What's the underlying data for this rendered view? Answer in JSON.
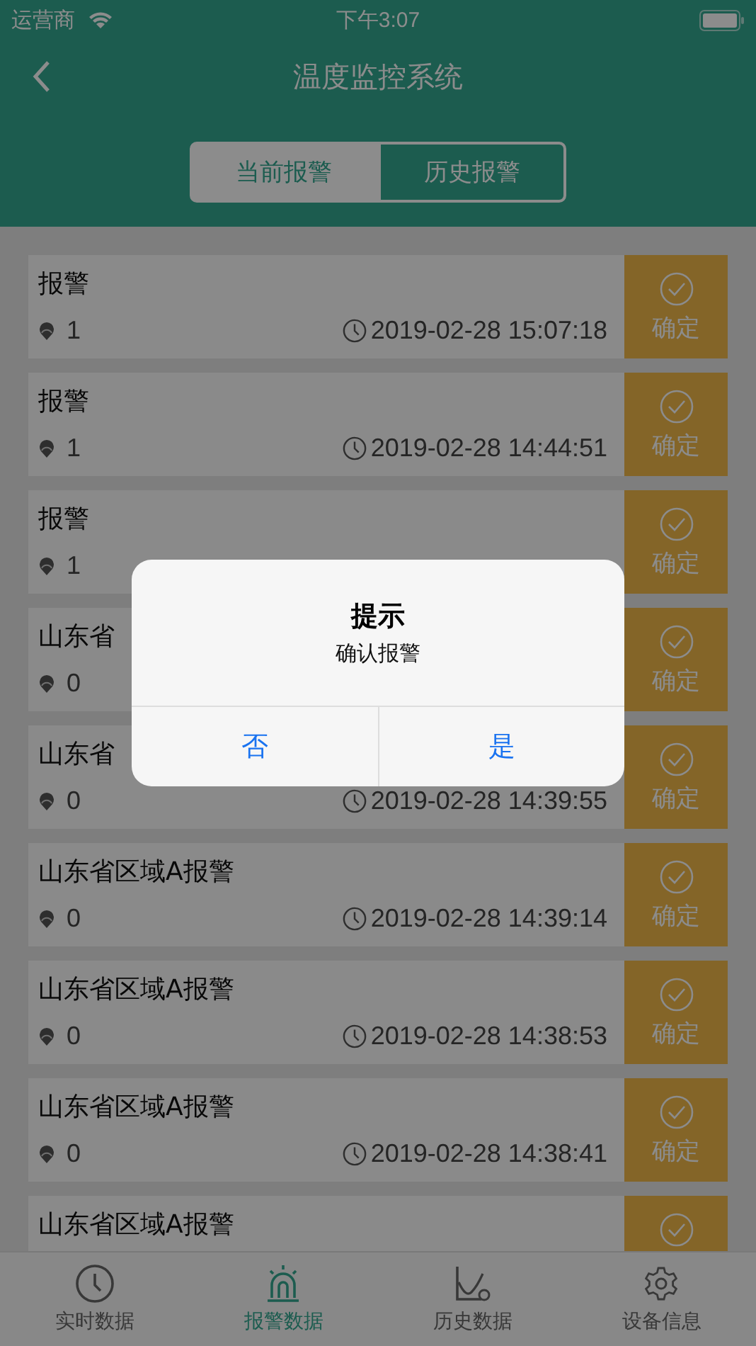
{
  "status_bar": {
    "carrier": "运营商",
    "time": "下午3:07"
  },
  "nav": {
    "title": "温度监控系统"
  },
  "segments": [
    {
      "label": "当前报警",
      "selected": true
    },
    {
      "label": "历史报警",
      "selected": false
    }
  ],
  "alarms": [
    {
      "title": "报警",
      "count": "1",
      "time": "2019-02-28 15:07:18",
      "confirm": "确定"
    },
    {
      "title": "报警",
      "count": "1",
      "time": "2019-02-28 14:44:51",
      "confirm": "确定"
    },
    {
      "title": "报警",
      "count": "1",
      "confirm": "确定"
    },
    {
      "title": "山东省",
      "count": "0",
      "confirm": "确定"
    },
    {
      "title": "山东省",
      "count": "0",
      "time": "2019-02-28 14:39:55",
      "confirm": "确定"
    },
    {
      "title": "山东省区域A报警",
      "count": "0",
      "time": "2019-02-28 14:39:14",
      "confirm": "确定"
    },
    {
      "title": "山东省区域A报警",
      "count": "0",
      "time": "2019-02-28 14:38:53",
      "confirm": "确定"
    },
    {
      "title": "山东省区域A报警",
      "count": "0",
      "time": "2019-02-28 14:38:41",
      "confirm": "确定"
    },
    {
      "title": "山东省区域A报警"
    }
  ],
  "tab_bar": [
    {
      "label": "实时数据",
      "kind": "clock",
      "selected": false
    },
    {
      "label": "报警数据",
      "kind": "alarm",
      "selected": true
    },
    {
      "label": "历史数据",
      "kind": "chart",
      "selected": false
    },
    {
      "label": "设备信息",
      "kind": "gear",
      "selected": false
    }
  ],
  "dialog": {
    "title": "提示",
    "message": "确认报警",
    "buttons": [
      "否",
      "是"
    ]
  }
}
